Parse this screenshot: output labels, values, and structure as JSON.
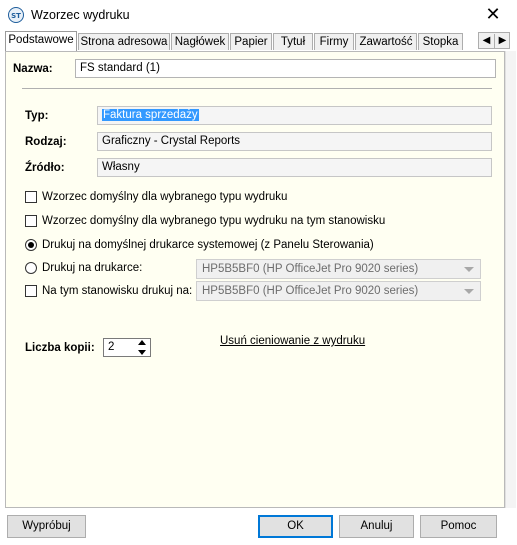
{
  "window": {
    "title": "Wzorzec wydruku",
    "icon": "ssf-app-icon",
    "close_glyph": "✕"
  },
  "tabs": [
    {
      "label": "Podstawowe",
      "active": true
    },
    {
      "label": "Strona adresowa"
    },
    {
      "label": "Nagłówek"
    },
    {
      "label": "Papier"
    },
    {
      "label": "Tytuł"
    },
    {
      "label": "Firmy"
    },
    {
      "label": "Zawartość"
    },
    {
      "label": "Stopka"
    }
  ],
  "tab_scroll": {
    "left": "◀",
    "right": "▶"
  },
  "form": {
    "nazwa_label": "Nazwa:",
    "nazwa_value": "FS standard (1)",
    "typ_label": "Typ:",
    "typ_value": "Faktura sprzedaży",
    "rodzaj_label": "Rodzaj:",
    "rodzaj_value": "Graficzny - Crystal Reports",
    "zrodlo_label": "Źródło:",
    "zrodlo_value": "Własny"
  },
  "options": {
    "default_type": {
      "label": "Wzorzec domyślny dla wybranego typu wydruku",
      "checked": false
    },
    "default_type_station": {
      "label": "Wzorzec domyślny dla wybranego typu wydruku na tym stanowisku",
      "checked": false
    },
    "print_default": {
      "label": "Drukuj na domyślnej drukarce systemowej (z Panelu Sterowania)",
      "selected": true
    },
    "print_on": {
      "label": "Drukuj na drukarce:",
      "selected": false,
      "printer": "HP5B5BF0 (HP OfficeJet Pro 9020 series)"
    },
    "station_print": {
      "label": "Na tym stanowisku drukuj na:",
      "checked": false,
      "printer": "HP5B5BF0 (HP OfficeJet Pro 9020 series)"
    }
  },
  "copies": {
    "label": "Liczba kopii:",
    "value": "2"
  },
  "remove_shading_link": "Usuń cieniowanie z wydruku",
  "buttons": {
    "test": "Wypróbuj",
    "ok": "OK",
    "cancel": "Anuluj",
    "help": "Pomoc"
  }
}
